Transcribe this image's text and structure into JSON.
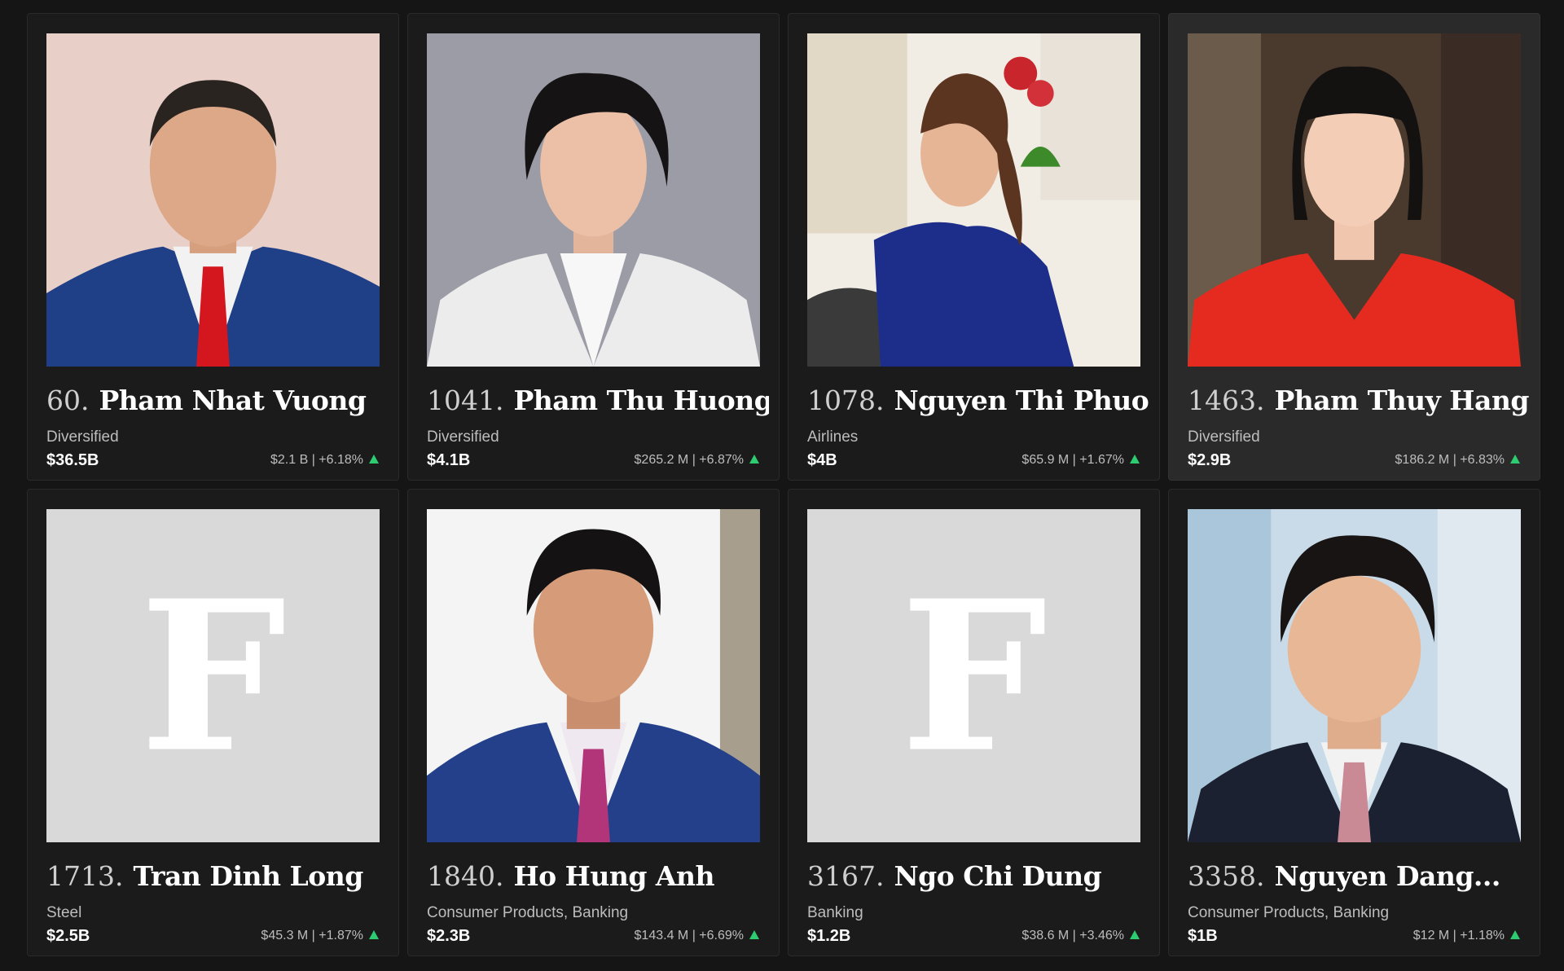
{
  "colors": {
    "background": "#151515",
    "card": "#1b1b1b",
    "card_hover": "#2a2a2a",
    "up": "#2ecc71"
  },
  "cards": [
    {
      "rank": "60.",
      "name": "Pham Nhat Vuong",
      "industry": "Diversified",
      "networth": "$36.5B",
      "change": "$2.1 B | +6.18%",
      "photo_icon": "person-photo"
    },
    {
      "rank": "1041.",
      "name": "Pham Thu Huong",
      "industry": "Diversified",
      "networth": "$4.1B",
      "change": "$265.2 M | +6.87%",
      "photo_icon": "person-photo"
    },
    {
      "rank": "1078.",
      "name": "Nguyen Thi Phuo...",
      "industry": "Airlines",
      "networth": "$4B",
      "change": "$65.9 M | +1.67%",
      "photo_icon": "person-photo"
    },
    {
      "rank": "1463.",
      "name": "Pham Thuy Hang",
      "industry": "Diversified",
      "networth": "$2.9B",
      "change": "$186.2 M | +6.83%",
      "photo_icon": "person-photo"
    },
    {
      "rank": "1713.",
      "name": "Tran Dinh Long",
      "industry": "Steel",
      "networth": "$2.5B",
      "change": "$45.3 M | +1.87%",
      "photo_icon": "forbes-f-placeholder-icon",
      "placeholder_letter": "F"
    },
    {
      "rank": "1840.",
      "name": "Ho Hung Anh",
      "industry": "Consumer Products, Banking",
      "networth": "$2.3B",
      "change": "$143.4 M | +6.69%",
      "photo_icon": "person-photo"
    },
    {
      "rank": "3167.",
      "name": "Ngo Chi Dung",
      "industry": "Banking",
      "networth": "$1.2B",
      "change": "$38.6 M | +3.46%",
      "photo_icon": "forbes-f-placeholder-icon",
      "placeholder_letter": "F"
    },
    {
      "rank": "3358.",
      "name": "Nguyen Dang...",
      "industry": "Consumer Products, Banking",
      "networth": "$1B",
      "change": "$12 M | +1.18%",
      "photo_icon": "person-photo"
    }
  ]
}
